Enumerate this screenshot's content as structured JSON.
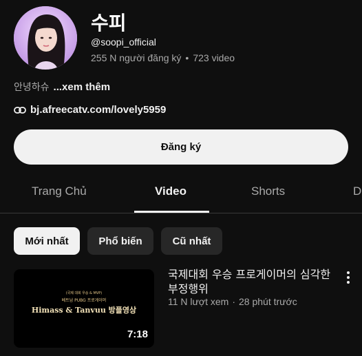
{
  "channel": {
    "name": "수피",
    "handle": "@soopi_official",
    "subscribers": "255 N người đăng ký",
    "separator": "•",
    "video_count": "723 video",
    "description": "안녕하슈",
    "more_label": "...xem thêm",
    "link": "bj.afreecatv.com/lovely5959",
    "link_icon": "link-icon",
    "avatar_icon": "avatar-photo"
  },
  "subscribe_label": "Đăng ký",
  "tabs": [
    {
      "label": "Trang Chủ"
    },
    {
      "label": "Video"
    },
    {
      "label": "Shorts"
    },
    {
      "label": "D"
    }
  ],
  "active_tab": "Video",
  "chips": [
    {
      "label": "Mới nhất"
    },
    {
      "label": "Phổ biến"
    },
    {
      "label": "Cũ nhất"
    }
  ],
  "selected_chip": "Mới nhất",
  "videos": [
    {
      "title": "국제대회 우승 프로게이머의 심각한 부정행위",
      "views": "11 N lượt xem",
      "separator": "·",
      "age": "28 phút trước",
      "duration": "7:18",
      "thumbnail": {
        "line1": "(국제 대회 우승 & MVP)",
        "line2": "베트남 PUBG 프로게이머",
        "title": "Himass & Tanvuu 방플영상"
      },
      "menu_icon": "more-vertical-icon"
    }
  ],
  "colors": {
    "background": "#0f0f0f",
    "text_primary": "#f1f1f1",
    "text_secondary": "#aaaaaa",
    "chip_bg": "#272727",
    "button_bg": "#f1f1f1"
  }
}
